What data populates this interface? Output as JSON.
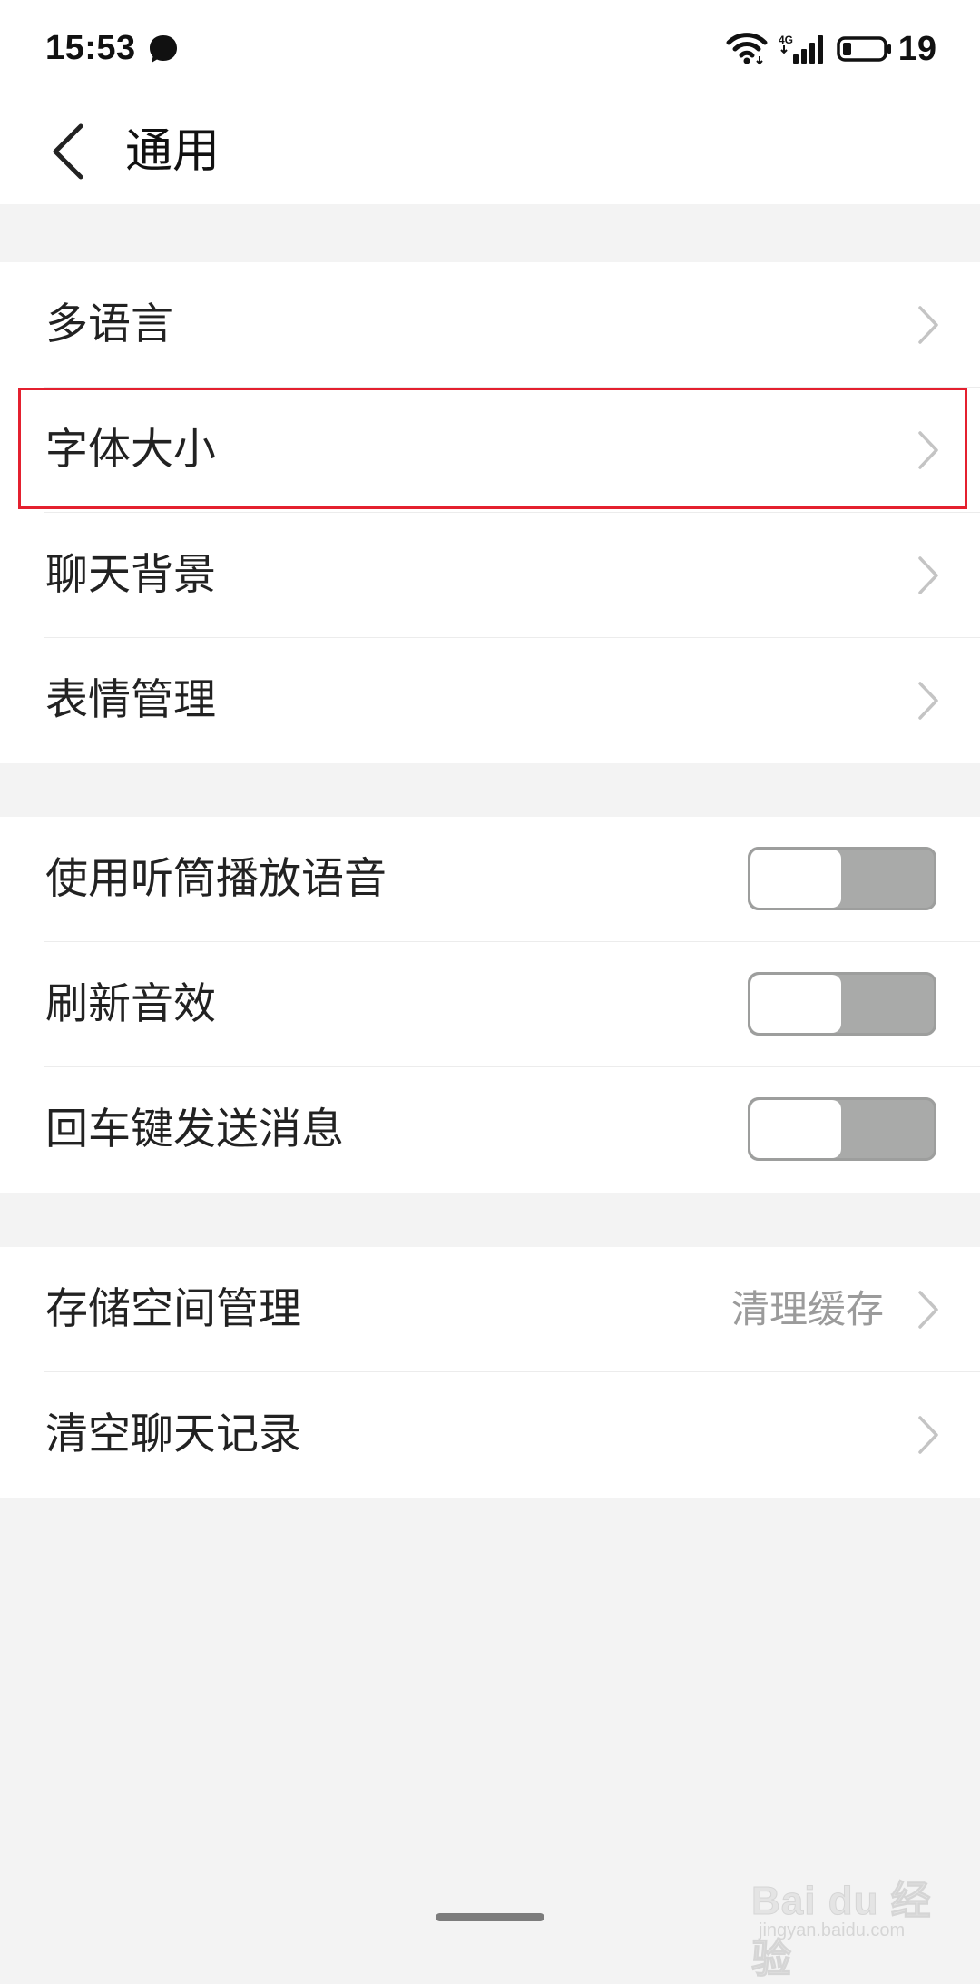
{
  "status_bar": {
    "time": "15:53",
    "battery_level": "19",
    "icons": [
      "notification-dot-icon",
      "wifi-icon",
      "4g-signal-icon",
      "battery-icon"
    ],
    "network_label": "4G"
  },
  "header": {
    "title": "通用",
    "back_icon": "back-arrow-icon"
  },
  "groups": [
    {
      "items": [
        {
          "label": "多语言",
          "control": "chevron"
        },
        {
          "label": "字体大小",
          "control": "chevron",
          "highlighted": true
        },
        {
          "label": "聊天背景",
          "control": "chevron"
        },
        {
          "label": "表情管理",
          "control": "chevron"
        }
      ]
    },
    {
      "items": [
        {
          "label": "使用听筒播放语音",
          "control": "toggle",
          "on": false
        },
        {
          "label": "刷新音效",
          "control": "toggle",
          "on": false
        },
        {
          "label": "回车键发送消息",
          "control": "toggle",
          "on": false
        }
      ]
    },
    {
      "items": [
        {
          "label": "存储空间管理",
          "value": "清理缓存",
          "control": "chevron"
        },
        {
          "label": "清空聊天记录",
          "control": "chevron"
        }
      ]
    }
  ],
  "watermark": {
    "main": "Bai du 经验",
    "sub": "jingyan.baidu.com"
  },
  "colors": {
    "highlight_border": "#e4202f",
    "toggle_off_track": "#a9aaa9",
    "background": "#f3f3f3",
    "secondary_text": "#9b9b9b"
  }
}
